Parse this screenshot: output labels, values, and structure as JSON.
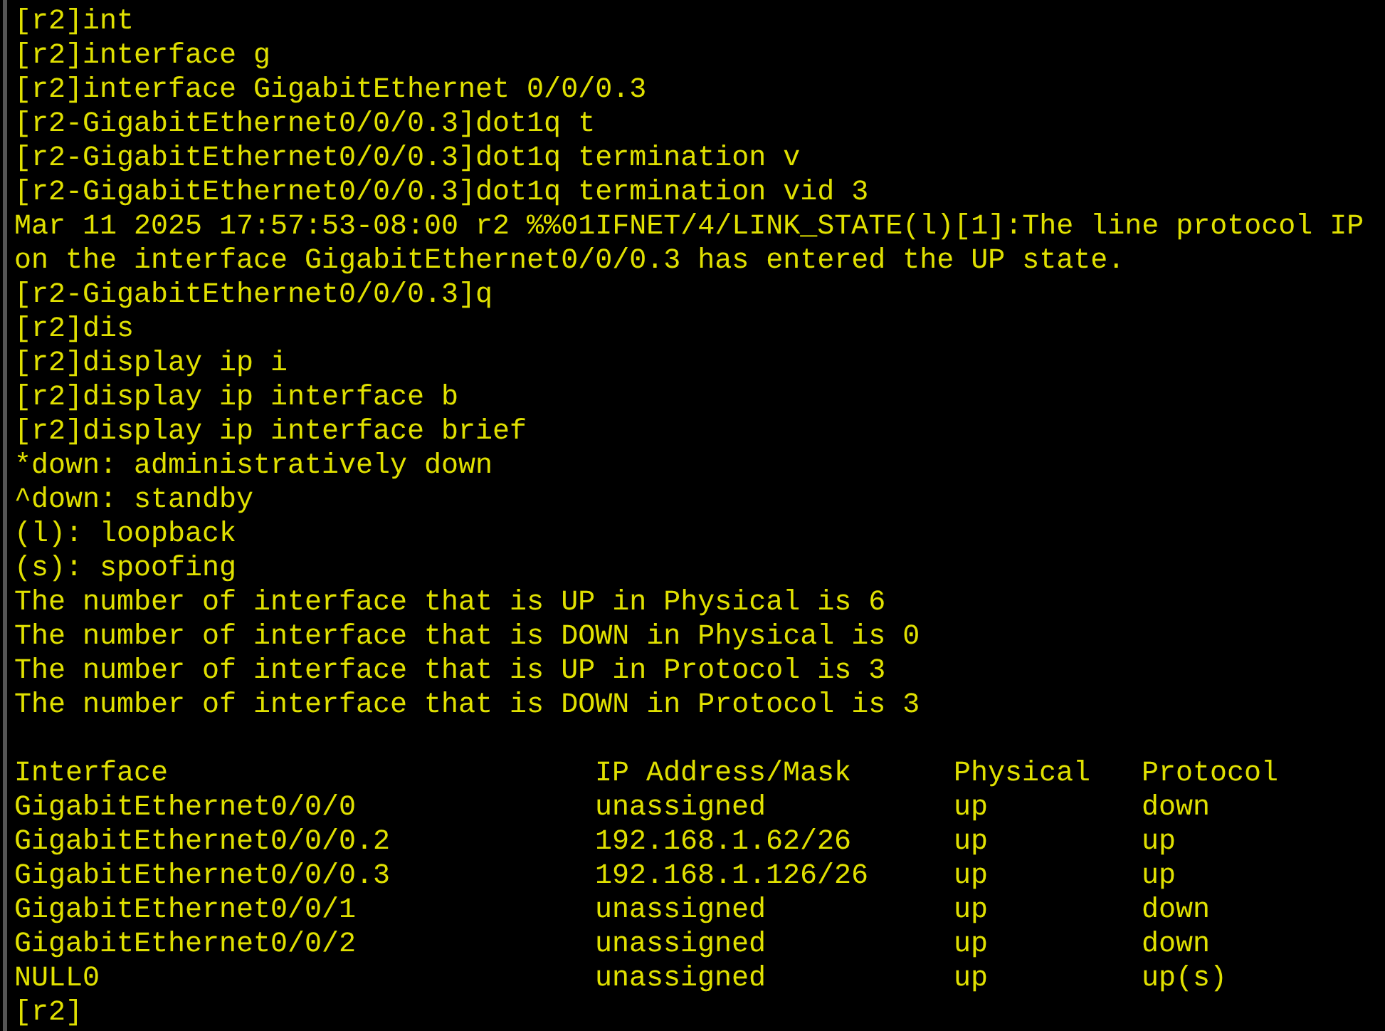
{
  "terminal": {
    "lines": [
      "[r2]int",
      "[r2]interface g",
      "[r2]interface GigabitEthernet 0/0/0.3",
      "[r2-GigabitEthernet0/0/0.3]dot1q t",
      "[r2-GigabitEthernet0/0/0.3]dot1q termination v",
      "[r2-GigabitEthernet0/0/0.3]dot1q termination vid 3",
      "Mar 11 2025 17:57:53-08:00 r2 %%01IFNET/4/LINK_STATE(l)[1]:The line protocol IP",
      "on the interface GigabitEthernet0/0/0.3 has entered the UP state.",
      "[r2-GigabitEthernet0/0/0.3]q",
      "[r2]dis",
      "[r2]display ip i",
      "[r2]display ip interface b",
      "[r2]display ip interface brief",
      "*down: administratively down",
      "^down: standby",
      "(l): loopback",
      "(s): spoofing",
      "The number of interface that is UP in Physical is 6",
      "The number of interface that is DOWN in Physical is 0",
      "The number of interface that is UP in Protocol is 3",
      "The number of interface that is DOWN in Protocol is 3"
    ],
    "table": {
      "columns": [
        "Interface",
        "IP Address/Mask",
        "Physical",
        "Protocol"
      ],
      "rows": [
        [
          "GigabitEthernet0/0/0",
          "unassigned",
          "up",
          "down"
        ],
        [
          "GigabitEthernet0/0/0.2",
          "192.168.1.62/26",
          "up",
          "up"
        ],
        [
          "GigabitEthernet0/0/0.3",
          "192.168.1.126/26",
          "up",
          "up"
        ],
        [
          "GigabitEthernet0/0/1",
          "unassigned",
          "up",
          "down"
        ],
        [
          "GigabitEthernet0/0/2",
          "unassigned",
          "up",
          "down"
        ],
        [
          "NULL0",
          "unassigned",
          "up",
          "up(s)"
        ]
      ]
    },
    "prompt": "[r2]"
  }
}
